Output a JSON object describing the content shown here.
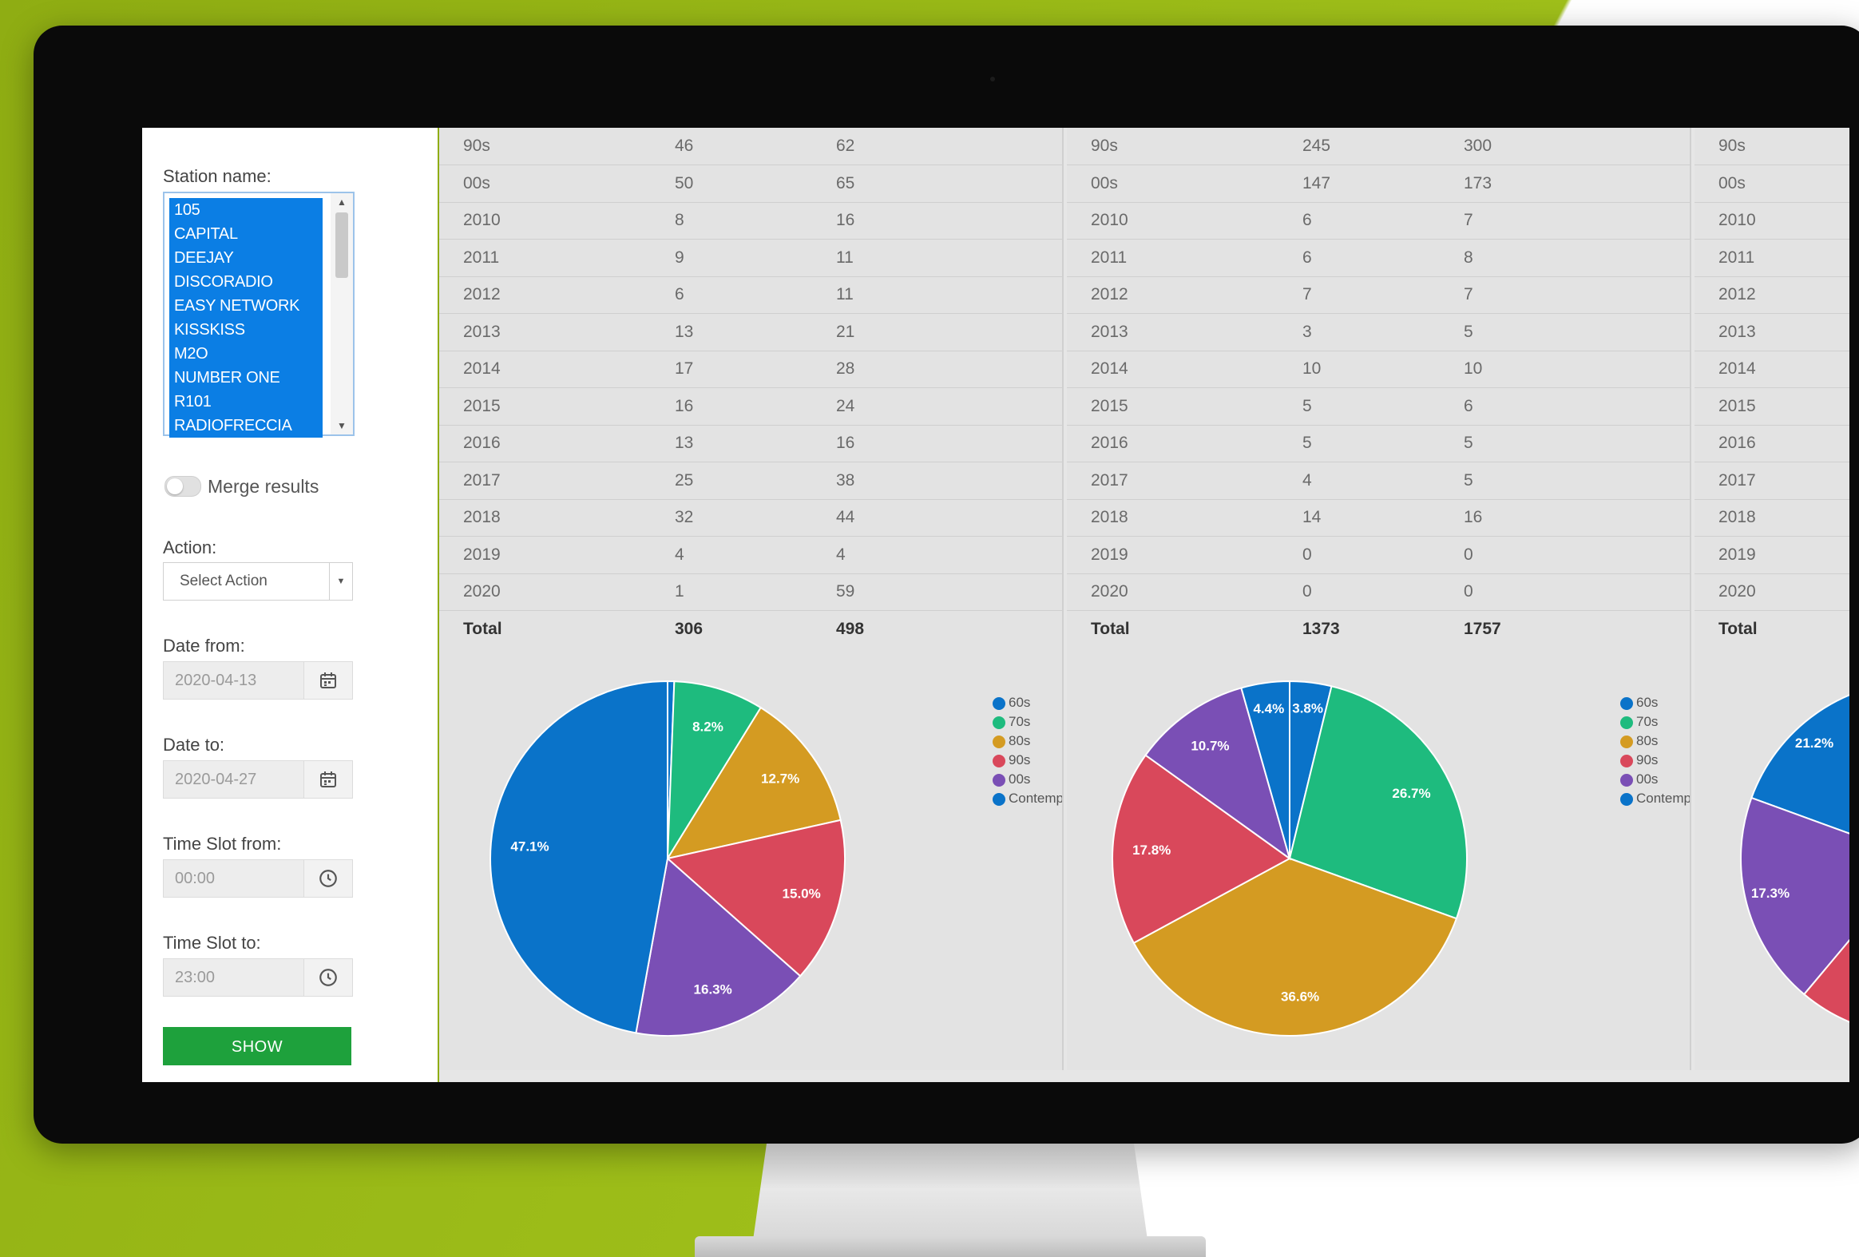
{
  "colors": {
    "c60s": "#0a73c9",
    "c70s": "#1ebb7e",
    "c80s": "#d49b22",
    "c90s": "#d9485b",
    "c00s": "#7a4fb5",
    "contemporary": "#0a73c9",
    "accent_green": "#1ea13c"
  },
  "sidebar": {
    "station_label": "Station name:",
    "stations": [
      "105",
      "CAPITAL",
      "DEEJAY",
      "DISCORADIO",
      "EASY NETWORK",
      "KISSKISS",
      "M2O",
      "NUMBER ONE",
      "R101",
      "RADIOFRECCIA"
    ],
    "merge_label": "Merge results",
    "action_label": "Action:",
    "action_value": "Select Action",
    "date_from_label": "Date from:",
    "date_from": "2020-04-13",
    "date_to_label": "Date to:",
    "date_to": "2020-04-27",
    "time_from_label": "Time Slot from:",
    "time_from": "00:00",
    "time_to_label": "Time Slot to:",
    "time_to": "23:00",
    "show_label": "SHOW"
  },
  "panels": [
    {
      "rows": [
        [
          "90s",
          "46",
          "62"
        ],
        [
          "00s",
          "50",
          "65"
        ],
        [
          "2010",
          "8",
          "16"
        ],
        [
          "2011",
          "9",
          "11"
        ],
        [
          "2012",
          "6",
          "11"
        ],
        [
          "2013",
          "13",
          "21"
        ],
        [
          "2014",
          "17",
          "28"
        ],
        [
          "2015",
          "16",
          "24"
        ],
        [
          "2016",
          "13",
          "16"
        ],
        [
          "2017",
          "25",
          "38"
        ],
        [
          "2018",
          "32",
          "44"
        ],
        [
          "2019",
          "4",
          "4"
        ],
        [
          "2020",
          "1",
          "59"
        ]
      ],
      "total": [
        "Total",
        "306",
        "498"
      ],
      "legend": [
        "60s",
        "70s",
        "80s",
        "90s",
        "00s",
        "Contemporary"
      ],
      "slice_labels": [
        "",
        "8.2%",
        "12.7%",
        "15.0%",
        "16.3%",
        "47.1%"
      ]
    },
    {
      "rows": [
        [
          "90s",
          "245",
          "300"
        ],
        [
          "00s",
          "147",
          "173"
        ],
        [
          "2010",
          "6",
          "7"
        ],
        [
          "2011",
          "6",
          "8"
        ],
        [
          "2012",
          "7",
          "7"
        ],
        [
          "2013",
          "3",
          "5"
        ],
        [
          "2014",
          "10",
          "10"
        ],
        [
          "2015",
          "5",
          "6"
        ],
        [
          "2016",
          "5",
          "5"
        ],
        [
          "2017",
          "4",
          "5"
        ],
        [
          "2018",
          "14",
          "16"
        ],
        [
          "2019",
          "0",
          "0"
        ],
        [
          "2020",
          "0",
          "0"
        ]
      ],
      "total": [
        "Total",
        "1373",
        "1757"
      ],
      "legend": [
        "60s",
        "70s",
        "80s",
        "90s",
        "00s",
        "Contemporary"
      ],
      "slice_labels": [
        "3.8%",
        "26.7%",
        "36.6%",
        "17.8%",
        "10.7%",
        "4.4%"
      ]
    },
    {
      "rows": [
        [
          "90s"
        ],
        [
          "00s"
        ],
        [
          "2010"
        ],
        [
          "2011"
        ],
        [
          "2012"
        ],
        [
          "2013"
        ],
        [
          "2014"
        ],
        [
          "2015"
        ],
        [
          "2016"
        ],
        [
          "2017"
        ],
        [
          "2018"
        ],
        [
          "2019"
        ],
        [
          "2020"
        ]
      ],
      "total": [
        "Total"
      ],
      "slice_labels": [
        "21.2%",
        "17.3%"
      ]
    }
  ],
  "chart_data": [
    {
      "type": "pie",
      "categories": [
        "60s",
        "70s",
        "80s",
        "90s",
        "00s",
        "Contemporary"
      ],
      "values": [
        0.6,
        8.2,
        12.7,
        15.0,
        16.3,
        47.1
      ]
    },
    {
      "type": "pie",
      "categories": [
        "60s",
        "70s",
        "80s",
        "90s",
        "00s",
        "Contemporary"
      ],
      "values": [
        3.8,
        26.7,
        36.6,
        17.8,
        10.7,
        4.4
      ]
    }
  ]
}
